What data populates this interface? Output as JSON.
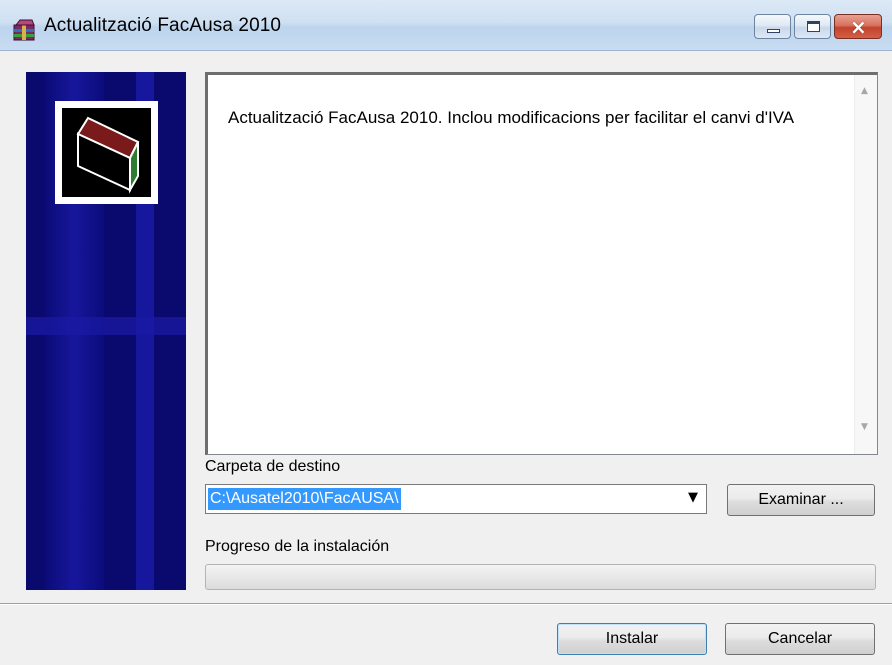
{
  "window": {
    "title": "Actualització FacAusa 2010"
  },
  "icons": {
    "app": "winrar-archive-icon",
    "logo": "box-icon"
  },
  "description": {
    "text": "Actualització FacAusa 2010. Inclou modificacions per facilitar el canvi d'IVA"
  },
  "destination": {
    "label": "Carpeta de destino",
    "value": "C:\\Ausatel2010\\FacAUSA\\",
    "browse_label": "Examinar ..."
  },
  "progress": {
    "label": "Progreso de la instalación",
    "value": 0
  },
  "buttons": {
    "install": "Instalar",
    "cancel": "Cancelar"
  },
  "colors": {
    "banner": "#0a0a6e",
    "selection": "#3399ff",
    "close_button": "#c2432b"
  }
}
